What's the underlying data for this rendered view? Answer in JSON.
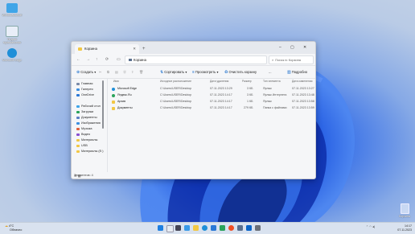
{
  "desktop": {
    "icons": [
      {
        "label": "Windows11Soft"
      },
      {
        "label": "Яндекс музыкальная"
      },
      {
        "label": "Microsoft Edge"
      }
    ],
    "recycle_bin_label": "Корзина"
  },
  "window": {
    "tab_title": "Корзина",
    "address": "Корзина",
    "search_placeholder": "Поиск в: Корзина",
    "toolbar": {
      "create": "Создать",
      "sort": "Сортировать",
      "view": "Просмотреть",
      "empty": "Очистить корзину",
      "more": "...",
      "details": "Подробно"
    },
    "sidebar": [
      {
        "label": "Главная"
      },
      {
        "label": "Галерея"
      },
      {
        "label": "OneDrive"
      },
      {
        "label": "Рабочий стол"
      },
      {
        "label": "Загрузки"
      },
      {
        "label": "Документы"
      },
      {
        "label": "Изображения"
      },
      {
        "label": "Музыка"
      },
      {
        "label": "Видео"
      },
      {
        "label": "Материалы"
      },
      {
        "label": "USB"
      },
      {
        "label": "Материалы (E:)"
      }
    ],
    "columns": [
      "Имя",
      "Исходное расположение",
      "Дата удаления",
      "Размер",
      "Тип элемента",
      "Дата изменения"
    ],
    "files": [
      {
        "name": "Microsoft Edge",
        "location": "C:\\Users\\USER\\Desktop",
        "deleted": "07.11.2023 13:29",
        "size": "3 КБ",
        "type": "Ярлык",
        "modified": "07.11.2023 13:27",
        "color": "#1f8fd8"
      },
      {
        "name": "Яндекс.Ru",
        "location": "C:\\Users\\USER\\Desktop",
        "deleted": "07.11.2023 14:17",
        "size": "3 КБ",
        "type": "Ярлык Интернета",
        "modified": "07.11.2023 13:48",
        "color": "#2aa35a"
      },
      {
        "name": "Архив",
        "location": "C:\\Users\\USER\\Desktop",
        "deleted": "07.11.2023 14:17",
        "size": "1 КБ",
        "type": "Ярлык",
        "modified": "07.11.2023 13:58",
        "color": "#f2c744"
      },
      {
        "name": "Документы",
        "location": "C:\\Users\\USER\\Desktop",
        "deleted": "07.11.2023 14:17",
        "size": "279 КБ",
        "type": "Папка с файлами",
        "modified": "07.11.2023 13:59",
        "color": "#f2c744"
      }
    ],
    "status": "Элементов: 4"
  },
  "taskbar": {
    "weather_temp": "4°C",
    "weather_desc": "Облачно",
    "time": "14:17",
    "date": "07.11.2023"
  }
}
